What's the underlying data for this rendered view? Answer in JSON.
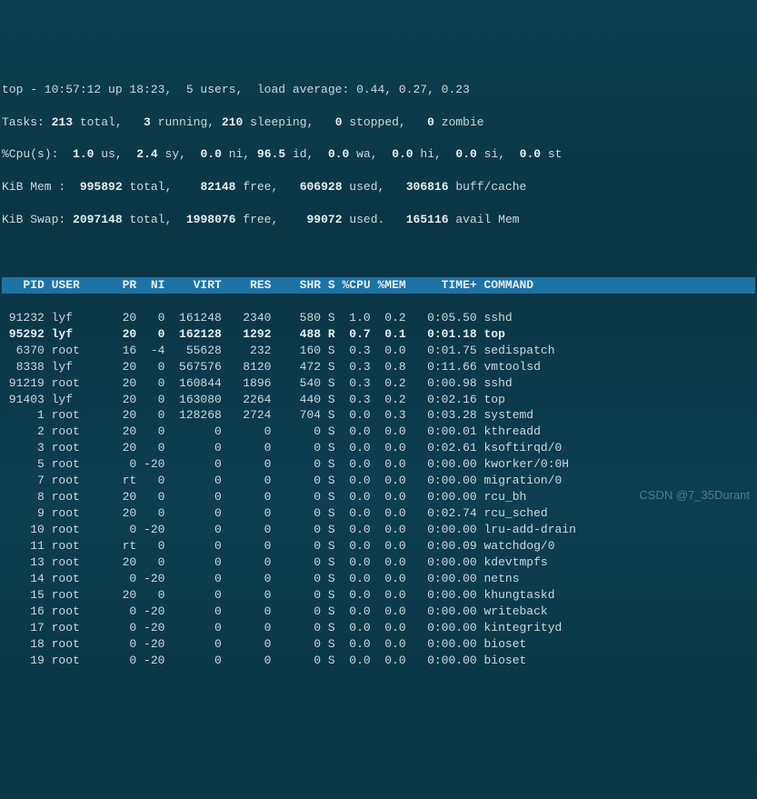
{
  "summary": {
    "line1_a": "top - 10:57:12 up 18:23,  5 users,  load average: 0.44, 0.27, 0.23",
    "tasks_label": "Tasks:",
    "tasks_total": " 213 ",
    "tasks_rest1": "total,   ",
    "tasks_running": "3 ",
    "tasks_rest2": "running, ",
    "tasks_sleeping": "210 ",
    "tasks_rest3": "sleeping,   ",
    "tasks_stopped": "0 ",
    "tasks_rest4": "stopped,   ",
    "tasks_zombie": "0 ",
    "tasks_rest5": "zombie",
    "cpu_label": "%Cpu(s): ",
    "cpu_us": " 1.0 ",
    "cpu_us_l": "us, ",
    "cpu_sy": " 2.4 ",
    "cpu_sy_l": "sy, ",
    "cpu_ni": " 0.0 ",
    "cpu_ni_l": "ni, ",
    "cpu_id": "96.5 ",
    "cpu_id_l": "id, ",
    "cpu_wa": " 0.0 ",
    "cpu_wa_l": "wa, ",
    "cpu_hi": " 0.0 ",
    "cpu_hi_l": "hi, ",
    "cpu_si": " 0.0 ",
    "cpu_si_l": "si, ",
    "cpu_st": " 0.0 ",
    "cpu_st_l": "st",
    "mem_label": "KiB Mem :  ",
    "mem_total": "995892 ",
    "mem_total_l": "total,    ",
    "mem_free": "82148 ",
    "mem_free_l": "free,   ",
    "mem_used": "606928 ",
    "mem_used_l": "used,   ",
    "mem_buff": "306816 ",
    "mem_buff_l": "buff/cache",
    "swap_label": "KiB Swap: ",
    "swap_total": "2097148 ",
    "swap_total_l": "total,  ",
    "swap_free": "1998076 ",
    "swap_free_l": "free,    ",
    "swap_used": "99072 ",
    "swap_used_l": "used.   ",
    "swap_avail": "165116 ",
    "swap_avail_l": "avail Mem "
  },
  "header": "   PID USER      PR  NI    VIRT    RES    SHR S %CPU %MEM     TIME+ COMMAND                 ",
  "rows": [
    " 91232 lyf       20   0  161248   2340    580 S  1.0  0.2   0:05.50 sshd",
    " 95292 lyf       20   0  162128   1292    488 R  0.7  0.1   0:01.18 top",
    "  6370 root      16  -4   55628    232    160 S  0.3  0.0   0:01.75 sedispatch",
    "  8338 lyf       20   0  567576   8120    472 S  0.3  0.8   0:11.66 vmtoolsd",
    " 91219 root      20   0  160844   1896    540 S  0.3  0.2   0:00.98 sshd",
    " 91403 lyf       20   0  163080   2264    440 S  0.3  0.2   0:02.16 top",
    "     1 root      20   0  128268   2724    704 S  0.0  0.3   0:03.28 systemd",
    "     2 root      20   0       0      0      0 S  0.0  0.0   0:00.01 kthreadd",
    "     3 root      20   0       0      0      0 S  0.0  0.0   0:02.61 ksoftirqd/0",
    "     5 root       0 -20       0      0      0 S  0.0  0.0   0:00.00 kworker/0:0H",
    "     7 root      rt   0       0      0      0 S  0.0  0.0   0:00.00 migration/0",
    "     8 root      20   0       0      0      0 S  0.0  0.0   0:00.00 rcu_bh",
    "     9 root      20   0       0      0      0 S  0.0  0.0   0:02.74 rcu_sched",
    "    10 root       0 -20       0      0      0 S  0.0  0.0   0:00.00 lru-add-drain",
    "    11 root      rt   0       0      0      0 S  0.0  0.0   0:00.09 watchdog/0",
    "    13 root      20   0       0      0      0 S  0.0  0.0   0:00.00 kdevtmpfs",
    "    14 root       0 -20       0      0      0 S  0.0  0.0   0:00.00 netns",
    "    15 root      20   0       0      0      0 S  0.0  0.0   0:00.00 khungtaskd",
    "    16 root       0 -20       0      0      0 S  0.0  0.0   0:00.00 writeback",
    "    17 root       0 -20       0      0      0 S  0.0  0.0   0:00.00 kintegrityd",
    "    18 root       0 -20       0      0      0 S  0.0  0.0   0:00.00 bioset",
    "    19 root       0 -20       0      0      0 S  0.0  0.0   0:00.00 bioset"
  ],
  "highlight_index": 1,
  "watermark": "CSDN @7_35Durant"
}
